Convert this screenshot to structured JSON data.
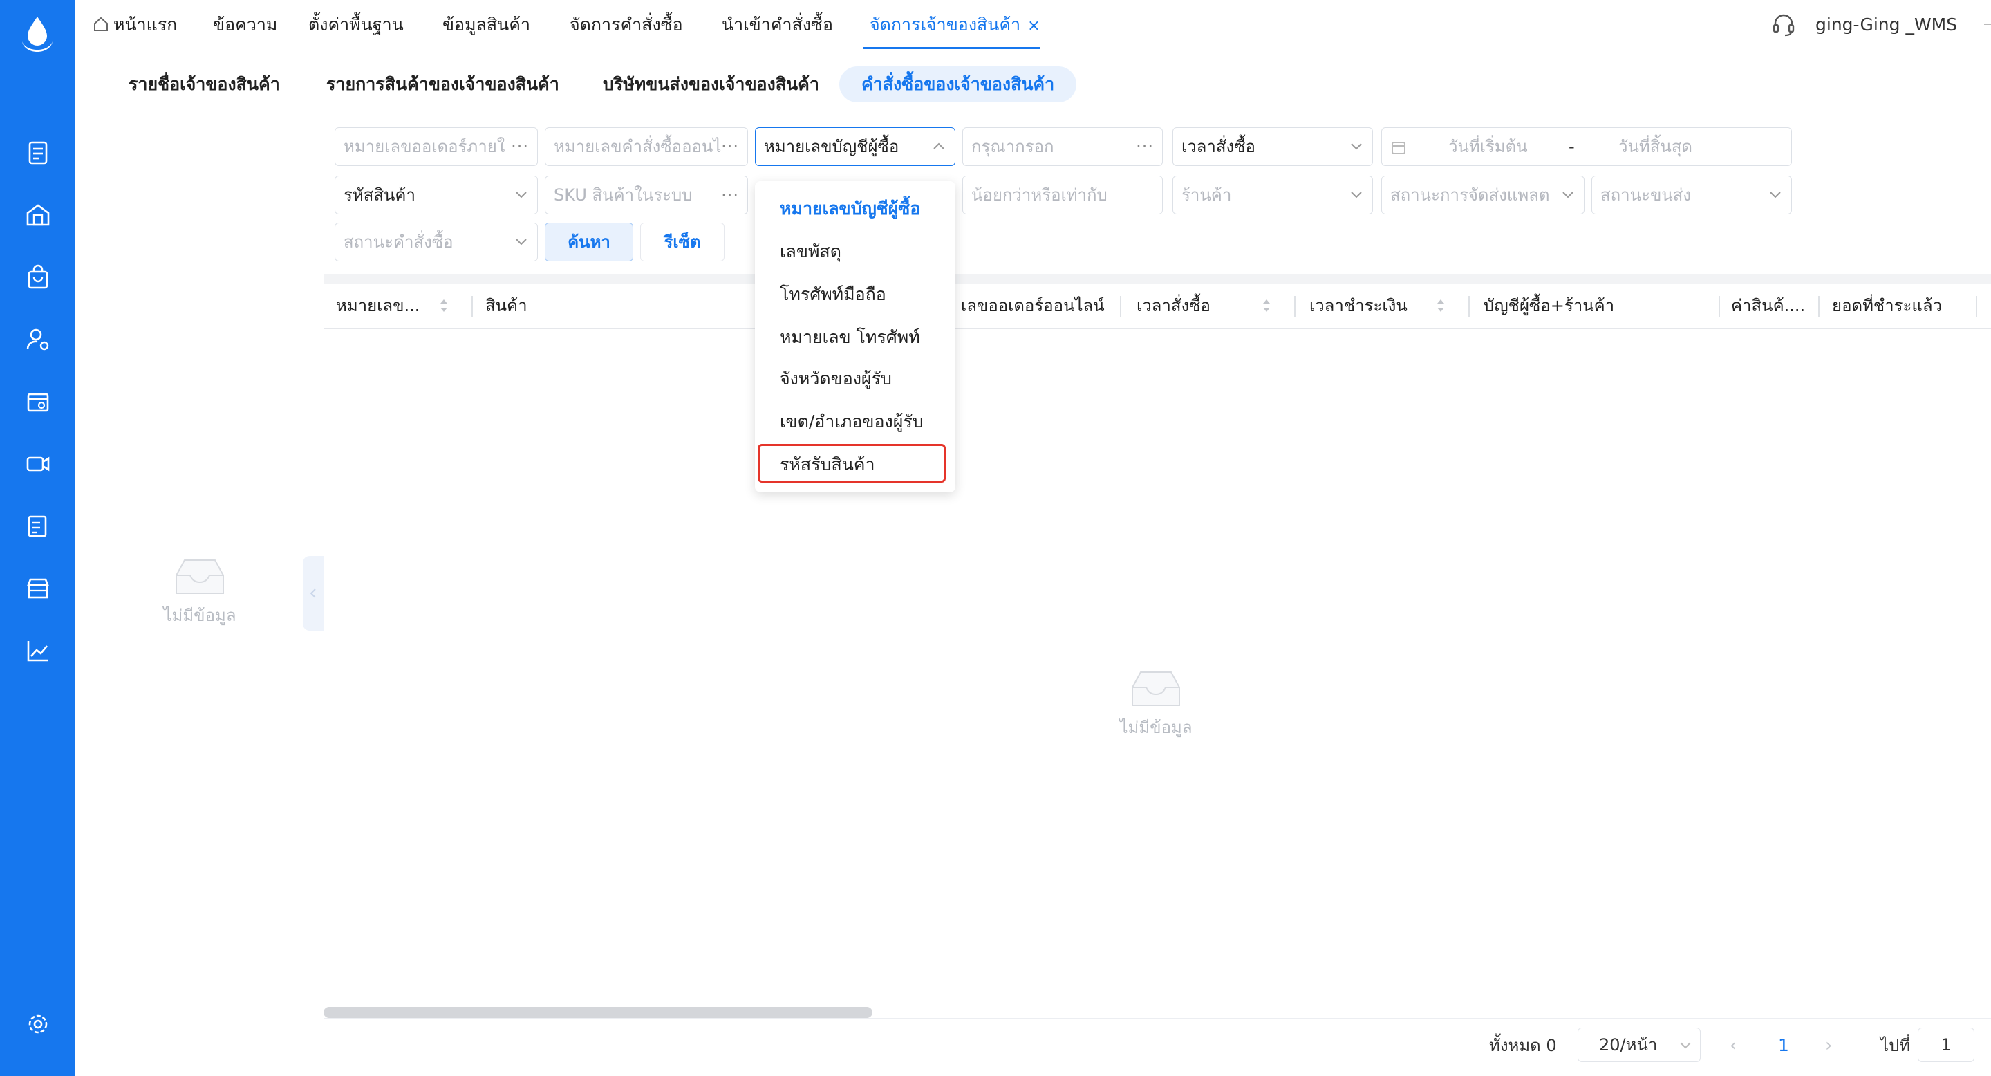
{
  "nav": {
    "tabs": [
      {
        "label": "หน้าแรก"
      },
      {
        "label": "ข้อความ"
      },
      {
        "label": "ตั้งค่าพื้นฐาน"
      },
      {
        "label": "ข้อมูลสินค้า"
      },
      {
        "label": "จัดการคำสั่งซื้อ"
      },
      {
        "label": "นำเข้าคำสั่งซื้อ"
      },
      {
        "label": "จัดการเจ้าของสินค้า"
      }
    ],
    "close_glyph": "×",
    "user": "ging-Ging _WMS"
  },
  "subtabs": [
    {
      "label": "รายชื่อเจ้าของสินค้า"
    },
    {
      "label": "รายการสินค้าของเจ้าของสินค้า"
    },
    {
      "label": "บริษัทขนส่งของเจ้าของสินค้า"
    },
    {
      "label": "คำสั่งซื้อของเจ้าของสินค้า"
    }
  ],
  "filters": {
    "external_order_placeholder": "หมายเลขออเดอร์ภายใ",
    "online_order_placeholder": "หมายเลขคำสั่งซื้อออนไ",
    "search_type_value": "หมายเลขบัญชีผู้ซื้อ",
    "keyword_placeholder": "กรุณากรอก",
    "time_type_value": "เวลาสั่งซื้อ",
    "start_date_placeholder": "วันที่เริ่มต้น",
    "date_separator": "-",
    "end_date_placeholder": "วันที่สิ้นสุด",
    "product_code_value": "รหัสสินค้า",
    "sku_placeholder": "SKU สินค้าในระบบ",
    "qty_placeholder": "น้อยกว่าหรือเท่ากับ",
    "shop_placeholder": "ร้านค้า",
    "platform_status_placeholder": "สถานะการจัดส่งแพลต",
    "shipping_status_placeholder": "สถานะขนส่ง",
    "order_status_placeholder": "สถานะคำสั่งซื้อ",
    "dots": "···",
    "search_button": "ค้นหา",
    "reset_button": "รีเซ็ต"
  },
  "dropdown": {
    "options": [
      {
        "label": "หมายเลขบัญชีผู้ซื้อ",
        "selected": true
      },
      {
        "label": "เลขพัสดุ"
      },
      {
        "label": "โทรศัพท์มือถือ"
      },
      {
        "label": "หมายเลข โทรศัพท์"
      },
      {
        "label": "จังหวัดของผู้รับ"
      },
      {
        "label": "เขต/อำเภอของผู้รับ"
      },
      {
        "label": "รหัสรับสินค้า",
        "highlighted": true
      }
    ]
  },
  "table": {
    "columns": [
      {
        "label": "หมายเลข..."
      },
      {
        "label": "สินค้า"
      },
      {
        "label": "เลขออเดอร์ออนไลน์"
      },
      {
        "label": "เวลาสั่งซื้อ"
      },
      {
        "label": "เวลาชำระเงิน"
      },
      {
        "label": "บัญชีผู้ซื้อ+ร้านค้า"
      },
      {
        "label": "ค่าสินค้...."
      },
      {
        "label": "ยอดที่ชำระแล้ว"
      }
    ],
    "empty_text": "ไม่มีข้อมูล"
  },
  "left_panel": {
    "empty_text": "ไม่มีข้อมูล"
  },
  "pagination": {
    "total": "ทั้งหมด 0",
    "page_size": "20/หน้า",
    "prev": "‹",
    "current_page": "1",
    "next": "›",
    "goto_label": "ไปที่",
    "goto_value": "1"
  },
  "colors": {
    "brand": "#1677ee",
    "highlight": "#e5342a"
  }
}
